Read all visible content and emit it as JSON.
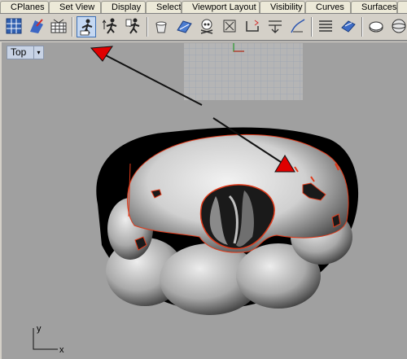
{
  "tabs": [
    "CPlanes",
    "Set View",
    "Display",
    "Select",
    "Viewport Layout",
    "Visibility",
    "Curves",
    "Surfaces",
    "S"
  ],
  "toolbar": {
    "icons": [
      "cplane-grid-icon",
      "surface-repair-icon",
      "mesh-wall-icon",
      "person-mesh-tool-icon",
      "person-move-tool-icon",
      "person-edit-tool-icon",
      "bucket-icon",
      "skew-surface-icon",
      "skull-icon",
      "rotate-frame-icon",
      "box-frame-icon",
      "trim-down-icon",
      "extend-curve-icon",
      "layer-lines-icon",
      "panel-surface-icon",
      "disc-icon",
      "sphere-icon"
    ]
  },
  "viewport": {
    "title": "Top",
    "menu_glyph": "▾",
    "axis_y": "y",
    "axis_x": "x"
  }
}
